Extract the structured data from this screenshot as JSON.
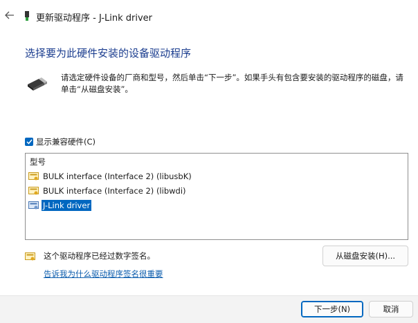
{
  "window": {
    "back_icon": "back-arrow-icon",
    "title": "更新驱动程序 - J-Link driver"
  },
  "heading": "选择要为此硬件安装的设备驱动程序",
  "instructions": "请选定硬件设备的厂商和型号，然后单击“下一步”。如果手头有包含要安装的驱动程序的磁盘，请单击“从磁盘安装”。",
  "compat_checkbox": {
    "label": "显示兼容硬件(C)",
    "checked": true
  },
  "model_list": {
    "header": "型号",
    "items": [
      {
        "label": "BULK interface (Interface 2) (libusbK)",
        "selected": false
      },
      {
        "label": "BULK interface (Interface 2) (libwdi)",
        "selected": false
      },
      {
        "label": "J-Link driver",
        "selected": true
      }
    ]
  },
  "signature": {
    "text": "这个驱动程序已经过数字签名。",
    "link": "告诉我为什么驱动程序签名很重要"
  },
  "buttons": {
    "have_disk": "从磁盘安装(H)...",
    "next": "下一步(N)",
    "cancel": "取消"
  },
  "colors": {
    "heading": "#1b3d8f",
    "accent": "#0067c0",
    "link": "#0b5cad"
  }
}
